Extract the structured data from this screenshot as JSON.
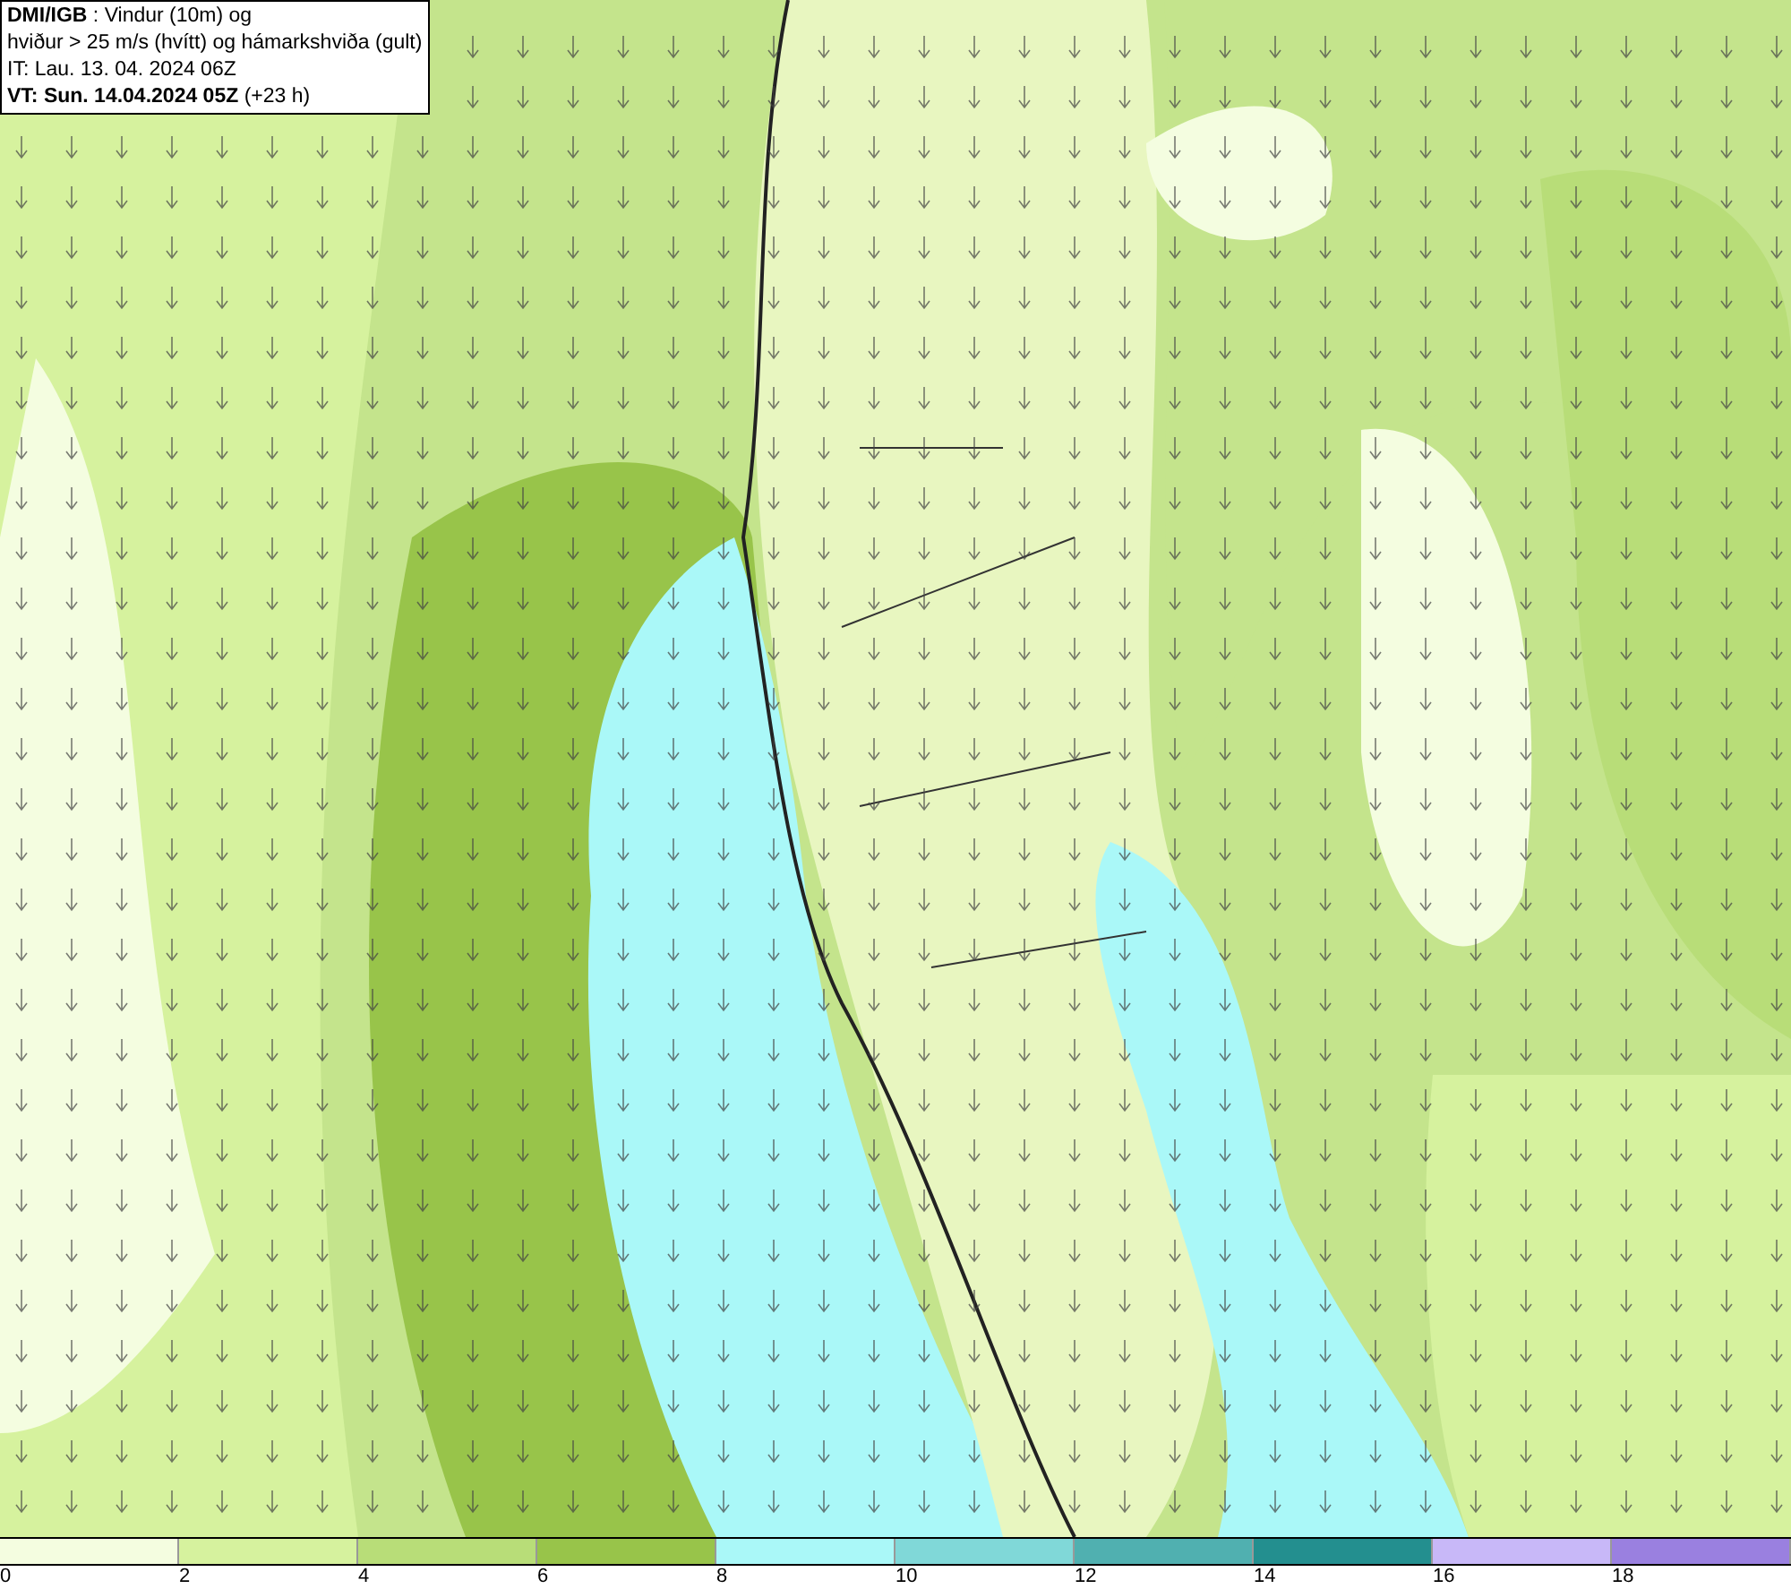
{
  "map": {
    "title_lines": [
      "**DMI/IGB** : Vindur (10m) og",
      "hviður > 25 m/s (hvítt) og hámarkshviða (gult)",
      "IT: Lau. 13. 04. 2024 06Z",
      "**VT: Sun. 14.04.2024 05Z** (+23 h)"
    ]
  },
  "legend": [
    {
      "color": "#f4fde0",
      "label": "0"
    },
    {
      "color": "#d6f29e",
      "label": "2"
    },
    {
      "color": "#b8dd78",
      "label": "4"
    },
    {
      "color": "#98c44a",
      "label": "6"
    },
    {
      "color": "#aaf8f8",
      "label": "8"
    },
    {
      "color": "#80d8d8",
      "label": "10"
    },
    {
      "color": "#50b0b0",
      "label": "12"
    },
    {
      "color": "#238f8f",
      "label": "14"
    },
    {
      "color": "#c8b8f8",
      "label": "16"
    },
    {
      "color": "#9a80e0",
      "label": "18"
    }
  ]
}
